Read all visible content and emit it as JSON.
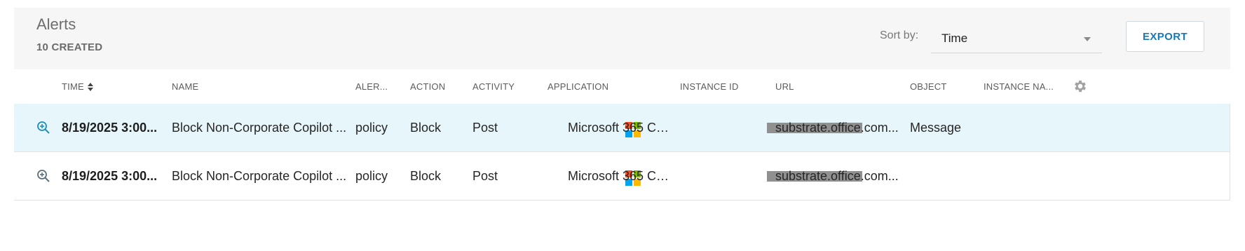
{
  "header": {
    "title": "Alerts",
    "count_label": "10 CREATED",
    "sort_label": "Sort by:",
    "sort_value": "Time",
    "export_label": "EXPORT"
  },
  "columns": [
    "TIME",
    "NAME",
    "ALER...",
    "ACTION",
    "ACTIVITY",
    "APPLICATION",
    "INSTANCE ID",
    "URL",
    "OBJECT",
    "INSTANCE NA..."
  ],
  "rows": [
    {
      "time": "8/19/2025 3:00...",
      "name": "Block Non-Corporate Copilot ...",
      "alert_type": "policy",
      "action": "Block",
      "activity": "Post",
      "application": "Microsoft 365 Co...",
      "url": "substrate.office.com...",
      "object": "Message",
      "instance_name": ""
    },
    {
      "time": "8/19/2025 3:00...",
      "name": "Block Non-Corporate Copilot ...",
      "alert_type": "policy",
      "action": "Block",
      "activity": "Post",
      "application": "Microsoft 365 Co...",
      "url": "substrate.office.com...",
      "object": "",
      "instance_name": ""
    }
  ],
  "icons": {
    "details": "zoom-in-icon",
    "settings": "gear-icon",
    "sort": "sort-icon",
    "dropdown": "chevron-down-icon",
    "app_logo": "microsoft-logo-icon"
  },
  "colors": {
    "accent": "#1a79b5",
    "selected_row": "#e6f6fa",
    "header_bg": "#f6f6f6",
    "ms_red": "#f25022",
    "ms_green": "#7fba00",
    "ms_blue": "#00a4ef",
    "ms_yellow": "#ffb900"
  }
}
